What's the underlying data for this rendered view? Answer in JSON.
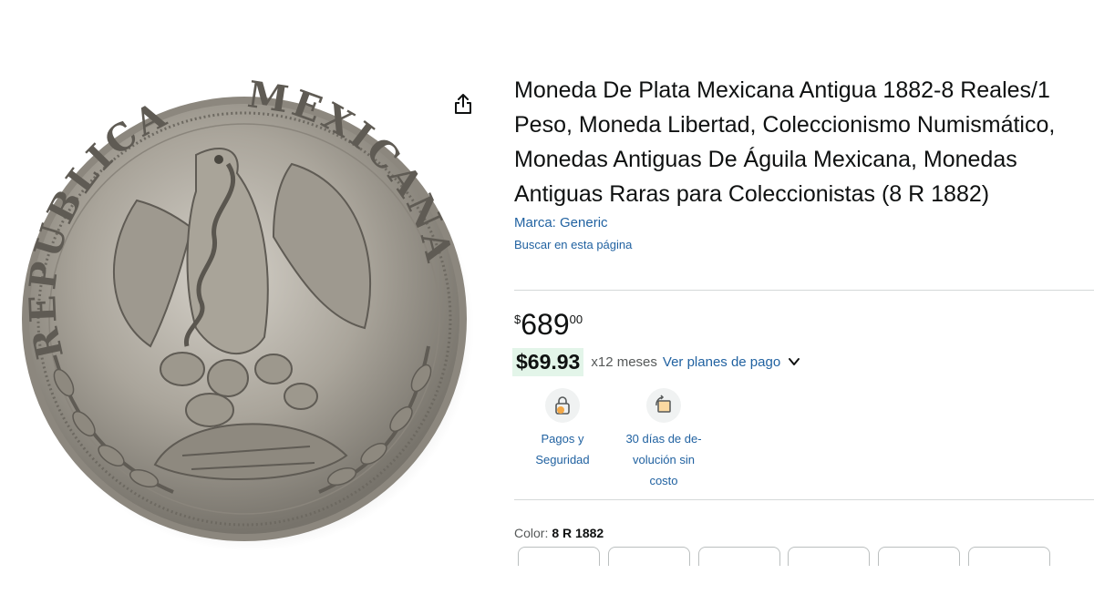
{
  "product": {
    "title": "Moneda De Plata Mexicana Antigua 1882-8 Reales/1 Peso, Moneda Libertad, Coleccionismo Numismático, Monedas Antiguas De Águila Mexicana, Monedas Antiguas Raras para Coleccionistas (8 R 1882)",
    "brand_label": "Marca: Generic",
    "search_link": "Buscar en esta página",
    "coin_inscription_left": "REPUBLICA",
    "coin_inscription_right": "MEXICANA"
  },
  "price": {
    "symbol": "$",
    "whole": "689",
    "fraction": "00"
  },
  "installment": {
    "amount": "$69.93",
    "months": "x12 meses",
    "link": "Ver planes de pago"
  },
  "features": [
    {
      "line1": "Pagos y",
      "line2": "Seguridad",
      "line3": "",
      "icon": "secure-payment-icon"
    },
    {
      "line1": "30 días de de-",
      "line2": "volución sin",
      "line3": "costo",
      "icon": "return-box-icon"
    }
  ],
  "color": {
    "label": "Color:",
    "value": "8 R 1882"
  },
  "icons": {
    "share": "share-icon",
    "chevron": "chevron-down-icon"
  },
  "colors": {
    "link": "#2162a1",
    "installment_bg": "#e3f5e9",
    "text": "#0f1111"
  }
}
